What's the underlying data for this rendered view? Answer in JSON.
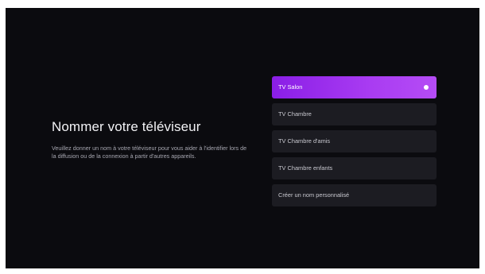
{
  "main": {
    "title": "Nommer votre téléviseur",
    "description": "Veuillez donner un nom à votre téléviseur pour vous aider à l'identifier lors de la diffusion ou de la connexion à partir d'autres appareils."
  },
  "options": [
    {
      "label": "TV Salon",
      "selected": true
    },
    {
      "label": "TV Chambre",
      "selected": false
    },
    {
      "label": "TV Chambre d'amis",
      "selected": false
    },
    {
      "label": "TV Chambre enfants",
      "selected": false
    },
    {
      "label": "Créer un nom personnalisé",
      "selected": false
    }
  ],
  "colors": {
    "background": "#0b0b0f",
    "option_background": "#1c1c22",
    "accent": "#a93cf2"
  },
  "icons": {
    "selected_indicator": "radio-dot-icon"
  }
}
